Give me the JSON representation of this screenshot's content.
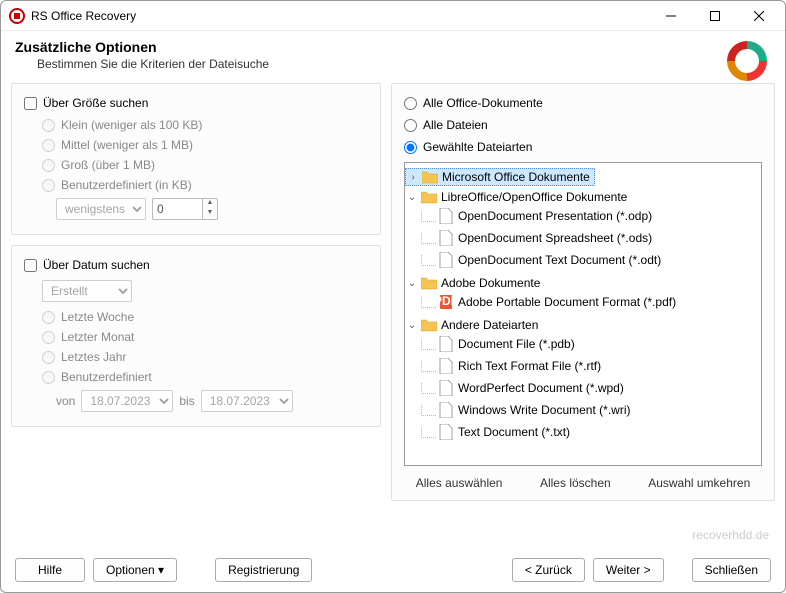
{
  "window": {
    "title": "RS Office Recovery"
  },
  "header": {
    "title": "Zusätzliche Optionen",
    "subtitle": "Bestimmen Sie die Kriterien der Dateisuche"
  },
  "size_panel": {
    "checkbox": "Über Größe suchen",
    "opt_small": "Klein (weniger als 100 KB)",
    "opt_medium": "Mittel (weniger als 1 MB)",
    "opt_large": "Groß (über 1 MB)",
    "opt_custom": "Benutzerdefiniert (in KB)",
    "custom_select": "wenigstens",
    "custom_value": "0"
  },
  "date_panel": {
    "checkbox": "Über Datum suchen",
    "type_select": "Erstellt",
    "opt_week": "Letzte Woche",
    "opt_month": "Letzter Monat",
    "opt_year": "Letztes Jahr",
    "opt_custom": "Benutzerdefiniert",
    "from_label": "von",
    "from_value": "18.07.2023",
    "to_label": "bis",
    "to_value": "18.07.2023"
  },
  "right_panel": {
    "rad_all_office": "Alle Office-Dokumente",
    "rad_all_files": "Alle Dateien",
    "rad_selected": "Gewählte Dateiarten",
    "tree": {
      "n0": "Microsoft Office Dokumente",
      "n1": "LibreOffice/OpenOffice Dokumente",
      "n1a": "OpenDocument Presentation (*.odp)",
      "n1b": "OpenDocument Spreadsheet (*.ods)",
      "n1c": "OpenDocument Text Document (*.odt)",
      "n2": "Adobe Dokumente",
      "n2a": "Adobe Portable Document Format (*.pdf)",
      "n3": "Andere Dateiarten",
      "n3a": "Document File (*.pdb)",
      "n3b": "Rich Text Format File (*.rtf)",
      "n3c": "WordPerfect Document (*.wpd)",
      "n3d": "Windows Write Document (*.wri)",
      "n3e": "Text Document (*.txt)"
    },
    "select_all": "Alles auswählen",
    "clear_all": "Alles löschen",
    "invert": "Auswahl umkehren"
  },
  "footer": {
    "help": "Hilfe",
    "options": "Optionen ▾",
    "register": "Registrierung",
    "back": "< Zurück",
    "next": "Weiter >",
    "close": "Schließen"
  },
  "watermark": "recoverhdd.de"
}
